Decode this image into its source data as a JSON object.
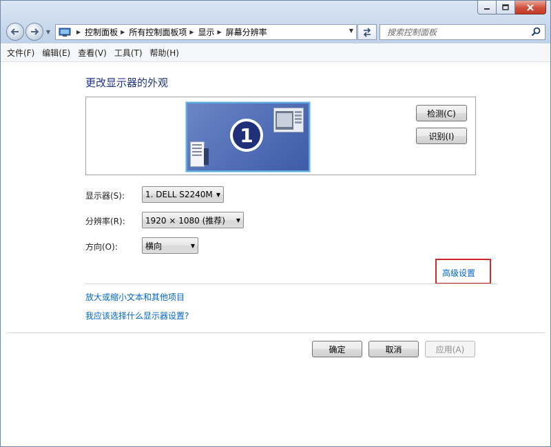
{
  "window": {
    "caption_buttons": [
      "minimize-icon",
      "maximize-icon",
      "close-icon"
    ]
  },
  "navigation": {
    "breadcrumbs": [
      "控制面板",
      "所有控制面板项",
      "显示",
      "屏幕分辨率"
    ],
    "search_placeholder": "搜索控制面板"
  },
  "menu": [
    "文件(F)",
    "编辑(E)",
    "查看(V)",
    "工具(T)",
    "帮助(H)"
  ],
  "content": {
    "title": "更改显示器的外观",
    "monitor_number": "1",
    "detect_button": "检测(C)",
    "identify_button": "识别(I)",
    "display": {
      "label": "显示器(S):",
      "value": "1. DELL S2240M"
    },
    "resolution": {
      "label": "分辨率(R):",
      "value": "1920 × 1080 (推荐)"
    },
    "orientation": {
      "label": "方向(O):",
      "value": "横向"
    },
    "advanced_link": "高级设置",
    "links": [
      "放大或缩小文本和其他项目",
      "我应该选择什么显示器设置?"
    ]
  },
  "footer": {
    "ok": "确定",
    "cancel": "取消",
    "apply": "应用(A)"
  },
  "colors": {
    "title": "#1e3287",
    "link": "#0066cc",
    "highlight_box": "#d02727"
  }
}
